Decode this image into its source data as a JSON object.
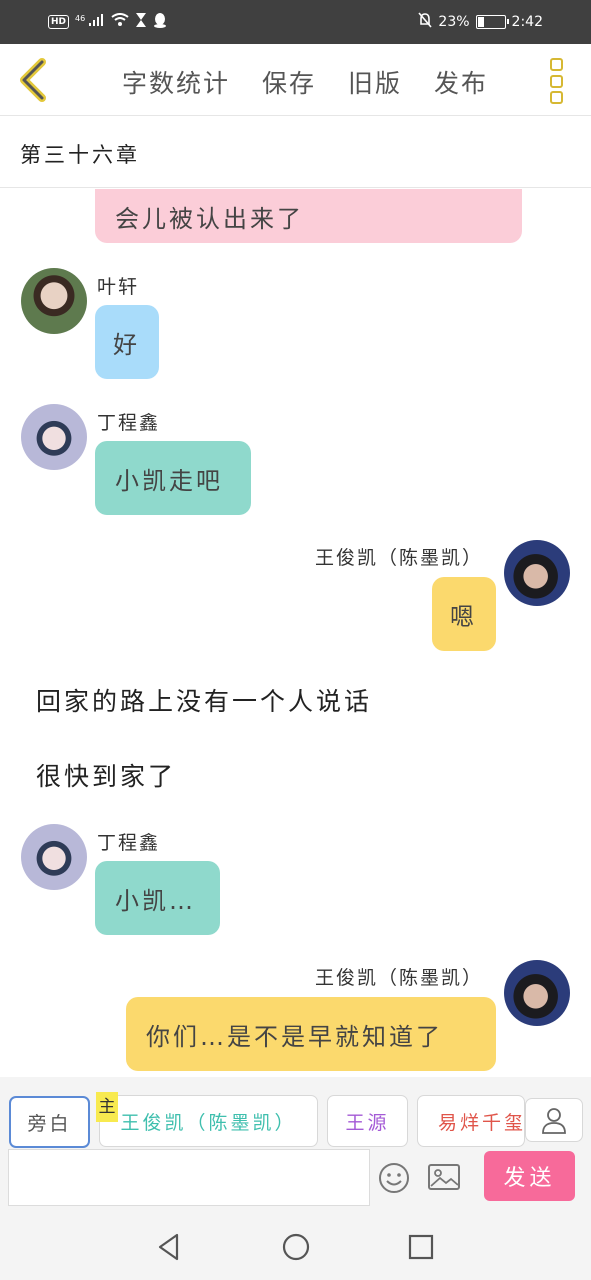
{
  "status_bar": {
    "hd": "HD",
    "network": "46",
    "battery_text": "23%",
    "battery_level": 0.23,
    "time": "2:42"
  },
  "toolbar": {
    "actions": [
      "字数统计",
      "保存",
      "旧版",
      "发布"
    ]
  },
  "chapter": {
    "title": "第三十六章"
  },
  "messages": [
    {
      "type": "bubble",
      "side": "left",
      "color": "pink",
      "text": "会儿被认出来了"
    },
    {
      "type": "chat",
      "side": "left",
      "color": "blue",
      "speaker": "叶轩",
      "text": "好"
    },
    {
      "type": "chat",
      "side": "left",
      "color": "teal",
      "speaker": "丁程鑫",
      "text": "小凯走吧"
    },
    {
      "type": "chat",
      "side": "right",
      "color": "yellow",
      "speaker": "王俊凯（陈墨凯）",
      "text": "嗯"
    },
    {
      "type": "narration",
      "text": "回家的路上没有一个人说话"
    },
    {
      "type": "narration",
      "text": "很快到家了"
    },
    {
      "type": "chat",
      "side": "left",
      "color": "teal",
      "speaker": "丁程鑫",
      "text": "小凯…"
    },
    {
      "type": "chat",
      "side": "right",
      "color": "yellow",
      "speaker": "王俊凯（陈墨凯）",
      "text": "你们…是不是早就知道了"
    }
  ],
  "roles": {
    "main_badge": "主",
    "items": [
      {
        "label": "旁白",
        "color": "#555555"
      },
      {
        "label": "王俊凯（陈墨凯）",
        "color": "#3fbfae"
      },
      {
        "label": "王源",
        "color": "#a45ad6"
      },
      {
        "label": "易烊千玺",
        "color": "#e0554a"
      }
    ]
  },
  "composer": {
    "input_value": "",
    "send_label": "发送"
  }
}
